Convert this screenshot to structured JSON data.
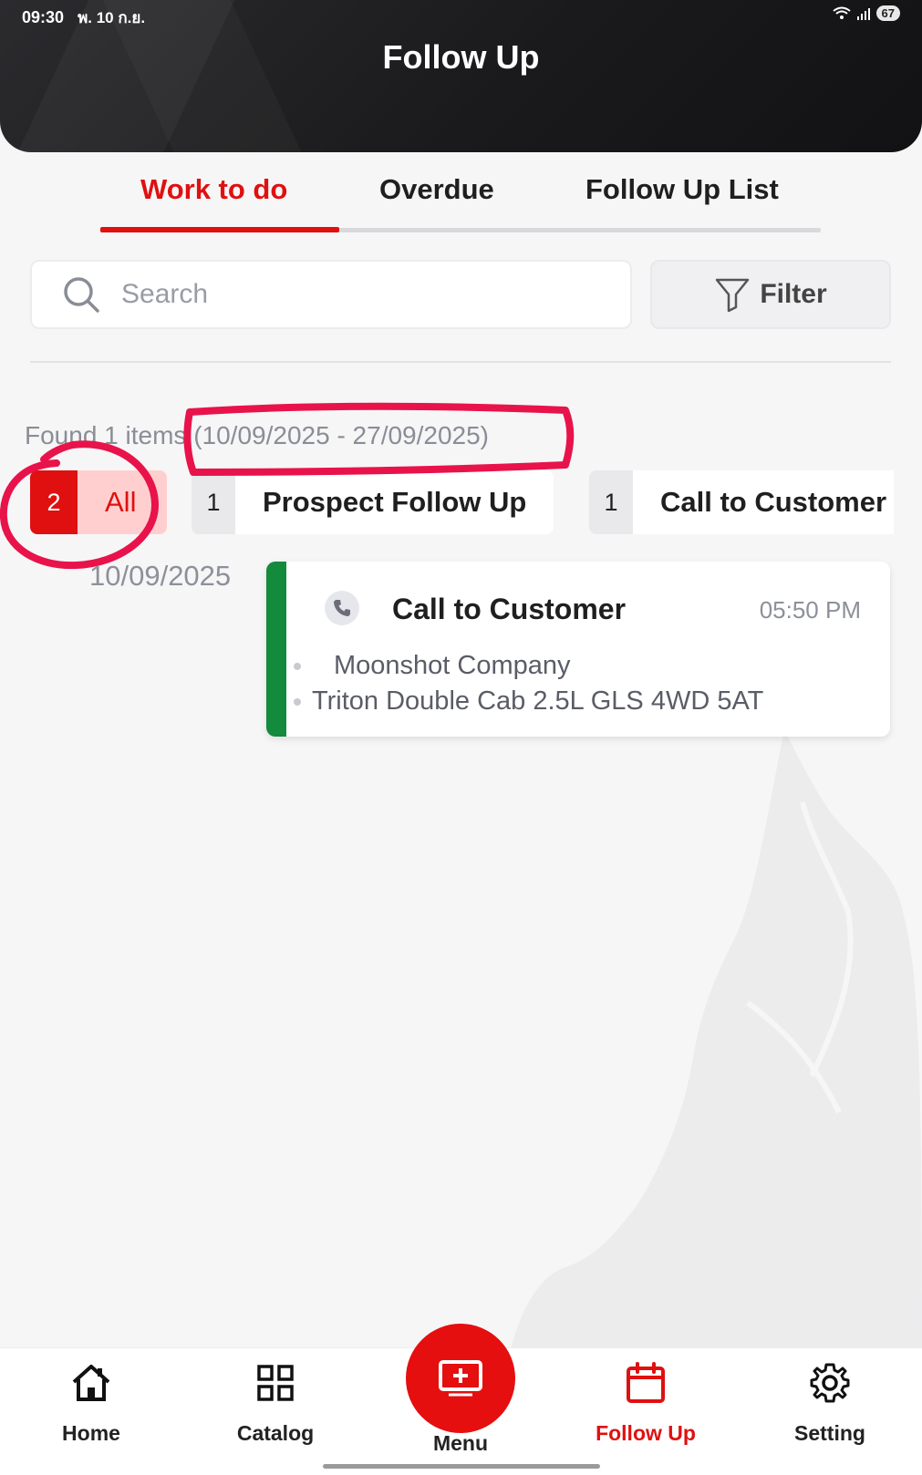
{
  "status_bar": {
    "time": "09:30",
    "date": "พ. 10 ก.ย.",
    "battery": "67"
  },
  "header": {
    "title": "Follow Up"
  },
  "tabs": [
    {
      "label": "Work to do",
      "active": true
    },
    {
      "label": "Overdue",
      "active": false
    },
    {
      "label": "Follow Up List",
      "active": false
    }
  ],
  "search": {
    "placeholder": "Search",
    "value": ""
  },
  "filter": {
    "label": "Filter"
  },
  "results": {
    "found_text": "Found 1 items",
    "date_range": "(10/09/2025 - 27/09/2025)"
  },
  "chips": [
    {
      "count": "2",
      "label": "All",
      "active": true
    },
    {
      "count": "1",
      "label": "Prospect Follow Up",
      "active": false
    },
    {
      "count": "1",
      "label": "Call to Customer",
      "active": false
    }
  ],
  "groups": [
    {
      "date": "10/09/2025",
      "items": [
        {
          "title": "Call to Customer",
          "time": "05:50 PM",
          "company": "Moonshot Company",
          "vehicle": "Triton Double Cab 2.5L GLS 4WD 5AT"
        }
      ]
    }
  ],
  "bottom_nav": [
    {
      "label": "Home",
      "icon": "home-icon"
    },
    {
      "label": "Catalog",
      "icon": "grid-icon"
    },
    {
      "label": "Menu",
      "icon": "plus-square-icon"
    },
    {
      "label": "Follow Up",
      "icon": "calendar-icon",
      "active": true
    },
    {
      "label": "Setting",
      "icon": "gear-icon"
    }
  ],
  "colors": {
    "accent": "#e01010",
    "header_bg": "#1a1a1c",
    "card_stripe": "#138a3c",
    "annotation": "#e8134a"
  }
}
